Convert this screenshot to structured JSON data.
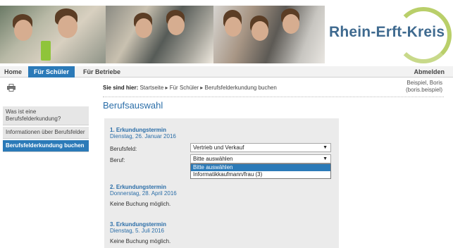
{
  "banner": {
    "logo_text": "Rhein-Erft-Kreis"
  },
  "nav": {
    "home": "Home",
    "schueler": "Für Schüler",
    "betriebe": "Für Betriebe",
    "abmelden": "Abmelden"
  },
  "breadcrumb": {
    "prefix": "Sie sind hier:",
    "path": "Startseite ▸ Für Schüler ▸ Berufsfelderkundung buchen"
  },
  "user": {
    "name": "Beispiel, Boris",
    "login": "(boris.beispiel)"
  },
  "sidebar": {
    "items": [
      {
        "label": "Was ist eine Berufsfelderkundung?"
      },
      {
        "label": "Informationen über Berufsfelder"
      },
      {
        "label": "Berufsfelderkundung buchen"
      }
    ]
  },
  "main": {
    "title": "Berufsauswahl",
    "termine": [
      {
        "title": "1. Erkundungstermin",
        "date": "Dienstag, 26. Januar 2016"
      },
      {
        "title": "2. Erkundungstermin",
        "date": "Donnerstag, 28. April 2016",
        "note": "Keine Buchung möglich."
      },
      {
        "title": "3. Erkundungstermin",
        "date": "Dienstag, 5. Juli 2016",
        "note": "Keine Buchung möglich."
      }
    ],
    "berufsfeld_label": "Berufsfeld:",
    "berufsfeld_value": "Vertrieb und Verkauf",
    "beruf_label": "Beruf:",
    "beruf_value": "Bitte auswählen",
    "beruf_options": [
      "Bitte auswählen",
      "Informatikkaufmann/frau (3)"
    ]
  },
  "colors": {
    "accent": "#2b7ab8",
    "title": "#2b6ea8",
    "panel": "#ebebeb"
  },
  "icons": {
    "print": "printer-icon",
    "dropdown": "chevron-down-icon"
  }
}
